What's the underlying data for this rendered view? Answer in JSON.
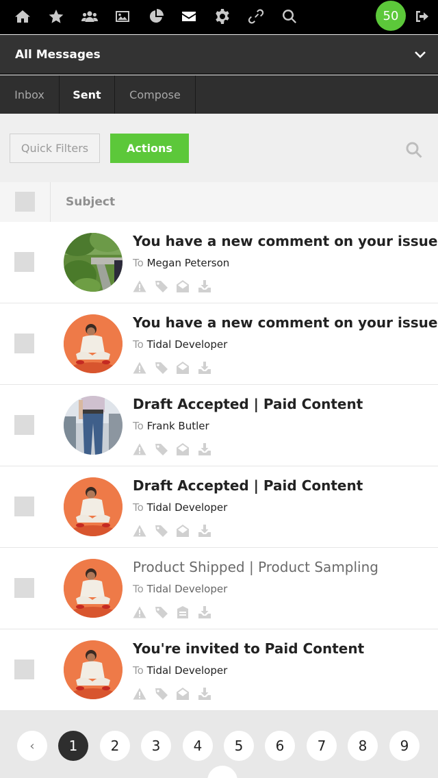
{
  "nav": {
    "icons": [
      "home-icon",
      "star-icon",
      "users-icon",
      "image-icon",
      "pie-chart-icon",
      "envelope-icon",
      "gear-icon",
      "link-icon",
      "search-icon"
    ],
    "active": "envelope-icon",
    "badge_count": "50",
    "badge_color": "#5cc83a",
    "logout_icon": "sign-out-icon"
  },
  "folder": {
    "title": "All Messages"
  },
  "tabs": [
    {
      "label": "Inbox",
      "active": false
    },
    {
      "label": "Sent",
      "active": true
    },
    {
      "label": "Compose",
      "active": false
    }
  ],
  "toolbar": {
    "filters_label": "Quick Filters",
    "actions_label": "Actions",
    "accent_color": "#5cc83a"
  },
  "list_header": {
    "subject_label": "Subject"
  },
  "messages": [
    {
      "subject": "You have a new comment on your issue",
      "to_label": "To",
      "recipient": "Megan Peterson",
      "avatar": "garden-photo",
      "read": false
    },
    {
      "subject": "You have a new comment on your issue",
      "to_label": "To",
      "recipient": "Tidal Developer",
      "avatar": "orange-portrait",
      "read": false
    },
    {
      "subject": "Draft Accepted | Paid Content",
      "to_label": "To",
      "recipient": "Frank Butler",
      "avatar": "jeans-photo",
      "read": false
    },
    {
      "subject": "Draft Accepted | Paid Content",
      "to_label": "To",
      "recipient": "Tidal Developer",
      "avatar": "orange-portrait",
      "read": false
    },
    {
      "subject": "Product Shipped | Product Sampling",
      "to_label": "To",
      "recipient": "Tidal Developer",
      "avatar": "orange-portrait",
      "read": true
    },
    {
      "subject": "You're invited to Paid Content",
      "to_label": "To",
      "recipient": "Tidal Developer",
      "avatar": "orange-portrait",
      "read": false
    }
  ],
  "row_actions": [
    "warning-icon",
    "tag-icon",
    "envelope-open-icon",
    "download-icon"
  ],
  "pagination": {
    "prev": "‹",
    "pages": [
      "1",
      "2",
      "3",
      "4",
      "5",
      "6",
      "7",
      "8",
      "9"
    ],
    "current": "1"
  }
}
